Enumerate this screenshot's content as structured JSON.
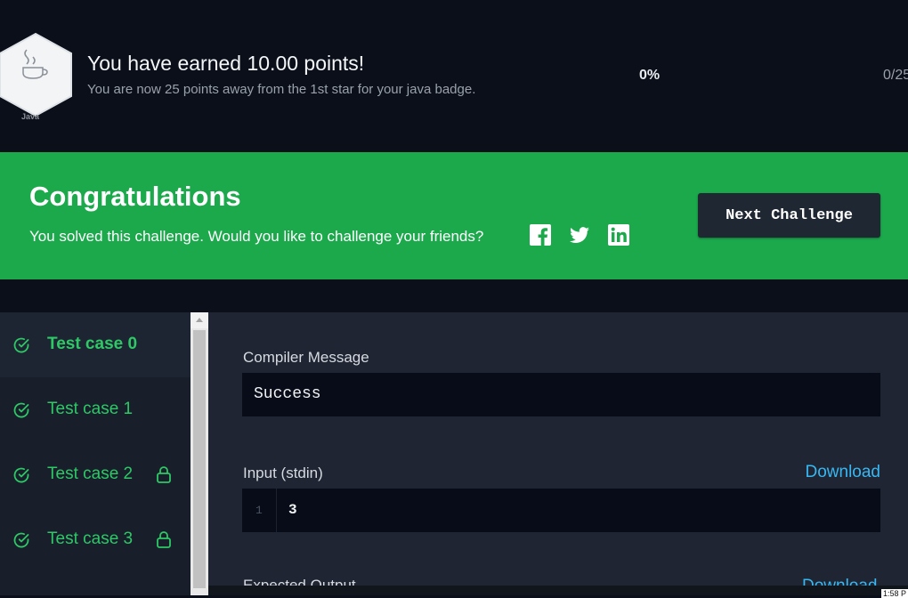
{
  "badge": {
    "label": "Java",
    "icon": "java-cup-icon",
    "title": "You have earned 10.00 points!",
    "subtitle": "You are now 25 points away from the 1st star for your java badge.",
    "progress_percent": "0%",
    "progress_ratio": "0/25"
  },
  "banner": {
    "title": "Congratulations",
    "message": "You solved this challenge. Would you like to challenge your friends?",
    "next_button": "Next Challenge",
    "color": "#1ba94c"
  },
  "test_cases": [
    {
      "label": "Test case 0",
      "status": "passed",
      "locked": false,
      "active": true
    },
    {
      "label": "Test case 1",
      "status": "passed",
      "locked": false,
      "active": false
    },
    {
      "label": "Test case 2",
      "status": "passed",
      "locked": true,
      "active": false
    },
    {
      "label": "Test case 3",
      "status": "passed",
      "locked": true,
      "active": false
    }
  ],
  "result": {
    "compiler_label": "Compiler Message",
    "compiler_message": "Success",
    "input_label": "Input (stdin)",
    "download_label": "Download",
    "input_line_number": "1",
    "input_value": "3",
    "expected_label": "Expected Output",
    "expected_download": "Download"
  },
  "clock": "1:58 P"
}
